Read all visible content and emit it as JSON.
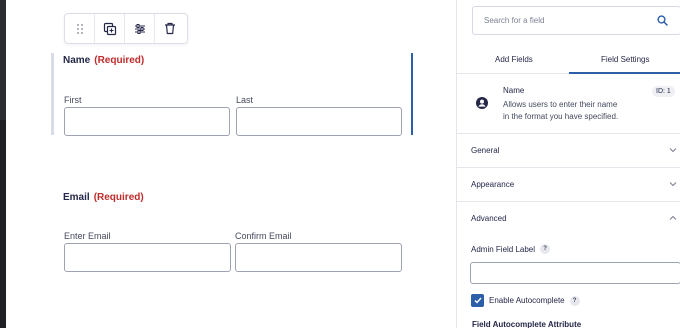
{
  "toolbar": {
    "buttons": [
      {
        "name": "drag-handle",
        "icon": "grip-dots-icon"
      },
      {
        "name": "duplicate",
        "icon": "duplicate-icon"
      },
      {
        "name": "settings",
        "icon": "sliders-icon"
      },
      {
        "name": "delete",
        "icon": "trash-icon"
      }
    ]
  },
  "form": {
    "name_field": {
      "label": "Name",
      "required_text": "(Required)",
      "first_label": "First",
      "last_label": "Last"
    },
    "email_field": {
      "label": "Email",
      "required_text": "(Required)",
      "enter_label": "Enter Email",
      "confirm_label": "Confirm Email"
    }
  },
  "sidebar": {
    "search_placeholder": "Search for a field",
    "tabs": [
      "Add Fields",
      "Field Settings"
    ],
    "active_tab": "Field Settings",
    "field_info": {
      "name": "Name",
      "description_line1": "Allows users to enter their name",
      "description_line2": "in the format you have specified.",
      "id_badge": "ID: 1"
    },
    "sections": [
      {
        "label": "General",
        "expanded": false
      },
      {
        "label": "Appearance",
        "expanded": false
      },
      {
        "label": "Advanced",
        "expanded": true
      }
    ],
    "advanced": {
      "admin_field_label": "Admin Field Label",
      "help_mark": "?",
      "admin_field_value": "",
      "enable_autocomplete_label": "Enable Autocomplete",
      "enable_autocomplete_checked": true,
      "autocomplete_attribute_title": "Field Autocomplete Attribute"
    }
  },
  "colors": {
    "accent": "#2c5fa8",
    "required": "#c02b2b",
    "text": "#242748"
  }
}
